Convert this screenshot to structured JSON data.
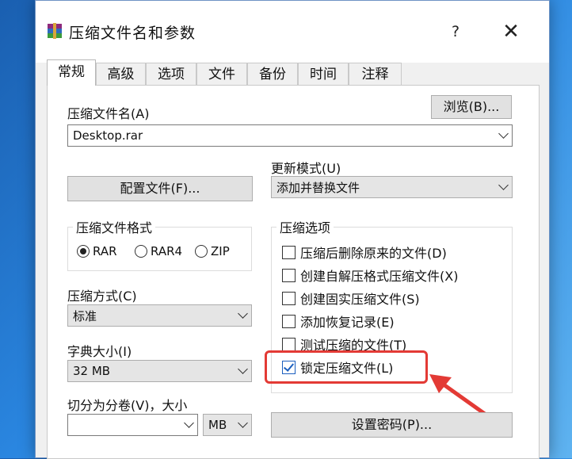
{
  "window": {
    "title": "压缩文件名和参数",
    "help": "?",
    "close": "✕"
  },
  "tabs": [
    "常规",
    "高级",
    "选项",
    "文件",
    "备份",
    "时间",
    "注释"
  ],
  "archive_name": {
    "label": "压缩文件名(A)",
    "value": "Desktop.rar",
    "browse": "浏览(B)..."
  },
  "profiles_button": "配置文件(F)...",
  "update_mode": {
    "label": "更新模式(U)",
    "value": "添加并替换文件"
  },
  "format": {
    "title": "压缩文件格式",
    "options": [
      "RAR",
      "RAR4",
      "ZIP"
    ],
    "selected": "RAR"
  },
  "method": {
    "label": "压缩方式(C)",
    "value": "标准"
  },
  "dictionary": {
    "label": "字典大小(I)",
    "value": "32 MB"
  },
  "split": {
    "label": "切分为分卷(V)，大小",
    "value": "",
    "unit": "MB"
  },
  "options": {
    "title": "压缩选项",
    "items": [
      {
        "label": "压缩后删除原来的文件(D)",
        "checked": false
      },
      {
        "label": "创建自解压格式压缩文件(X)",
        "checked": false
      },
      {
        "label": "创建固实压缩文件(S)",
        "checked": false
      },
      {
        "label": "添加恢复记录(E)",
        "checked": false
      },
      {
        "label": "测试压缩的文件(T)",
        "checked": false
      },
      {
        "label": "锁定压缩文件(L)",
        "checked": true
      }
    ]
  },
  "password_button": "设置密码(P)...",
  "colors": {
    "highlight": "#e33a35",
    "accent": "#1b5fbf"
  }
}
